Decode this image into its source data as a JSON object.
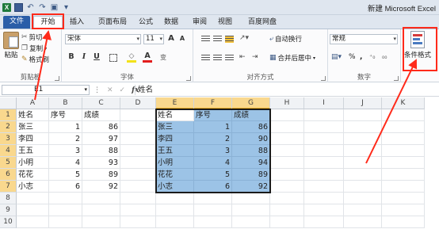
{
  "window": {
    "title": "新建 Microsoft Excel"
  },
  "tabs": [
    {
      "label": "文件"
    },
    {
      "label": "开始"
    },
    {
      "label": "插入"
    },
    {
      "label": "页面布局"
    },
    {
      "label": "公式"
    },
    {
      "label": "数据"
    },
    {
      "label": "审阅"
    },
    {
      "label": "视图"
    },
    {
      "label": "百度网盘"
    }
  ],
  "ribbon": {
    "clipboard": {
      "label": "剪贴板",
      "paste": "粘贴",
      "cut": "剪切",
      "copy": "复制",
      "format_painter": "格式刷"
    },
    "font": {
      "label": "字体",
      "name": "宋体",
      "size": "11",
      "grow": "A",
      "shrink": "A",
      "bold": "B",
      "italic": "I",
      "underline": "U",
      "font_color": "A"
    },
    "alignment": {
      "label": "对齐方式",
      "wrap": "自动换行",
      "merge": "合并后居中"
    },
    "number": {
      "label": "数字",
      "format": "常规",
      "percent": "%",
      "comma": ","
    },
    "styles": {
      "conditional_format": "条件格式"
    }
  },
  "formula_bar": {
    "name_box": "E1",
    "fx": "fx",
    "value": "姓名"
  },
  "columns": [
    "A",
    "B",
    "C",
    "D",
    "E",
    "F",
    "G",
    "H",
    "I",
    "J",
    "K"
  ],
  "rows": [
    "1",
    "2",
    "3",
    "4",
    "5",
    "6",
    "7",
    "8",
    "9",
    "10"
  ],
  "table_left": {
    "headers": [
      "姓名",
      "序号",
      "成绩"
    ],
    "rows": [
      [
        "张三",
        "1",
        "86"
      ],
      [
        "李四",
        "2",
        "97"
      ],
      [
        "王五",
        "3",
        "88"
      ],
      [
        "小明",
        "4",
        "93"
      ],
      [
        "花花",
        "5",
        "89"
      ],
      [
        "小志",
        "6",
        "92"
      ]
    ]
  },
  "table_right": {
    "headers": [
      "姓名",
      "序号",
      "成绩"
    ],
    "rows": [
      [
        "张三",
        "1",
        "86"
      ],
      [
        "李四",
        "2",
        "90"
      ],
      [
        "王五",
        "3",
        "88"
      ],
      [
        "小明",
        "4",
        "94"
      ],
      [
        "花花",
        "5",
        "89"
      ],
      [
        "小志",
        "6",
        "92"
      ]
    ]
  },
  "colors": {
    "highlight": "#9cc3e6",
    "annotation": "#ff2a1a",
    "file_tab": "#2a5ea8"
  }
}
